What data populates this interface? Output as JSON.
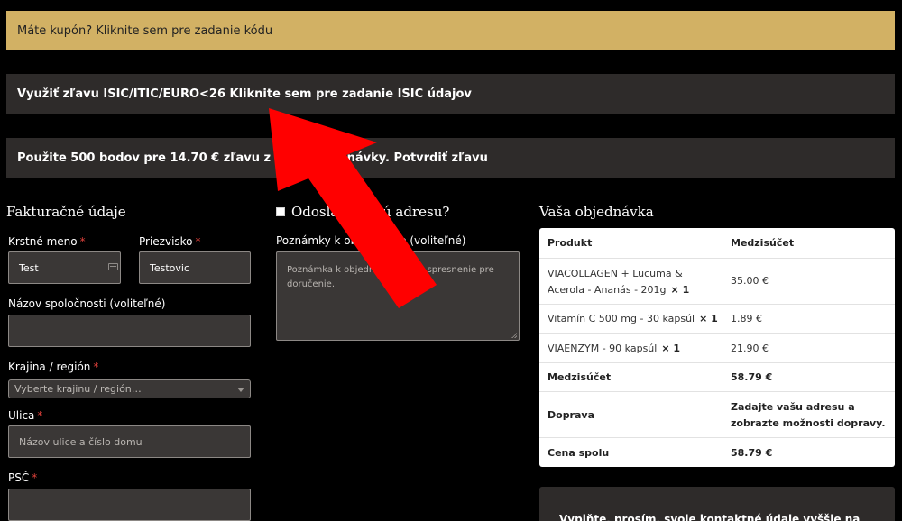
{
  "notices": {
    "coupon": "Máte kupón? Kliknite sem pre zadanie kódu",
    "isic": "Využiť zľavu ISIC/ITIC/EURO<26 Kliknite sem pre zadanie ISIC údajov",
    "points": "Použite 500 bodov pre 14.70 € zľavu z tejto objednávky. Potvrdiť zľavu"
  },
  "billing": {
    "heading": "Fakturačné údaje",
    "first_name_label": "Krstné meno",
    "first_name_value": "Test",
    "last_name_label": "Priezvisko",
    "last_name_value": "Testovic",
    "company_label": "Názov spoločnosti (voliteľné)",
    "country_label": "Krajina / región",
    "country_placeholder": "Vyberte krajinu / región…",
    "street_label": "Ulica",
    "street_placeholder": "Názov ulice a číslo domu",
    "zip_label": "PSČ",
    "required_mark": "*"
  },
  "shipping": {
    "different_address_label": "Odoslať na inú adresu?",
    "notes_label": "Poznámky k objednávke (voliteľné)",
    "notes_placeholder": "Poznámka k objednávke, napr. spresnenie pre doručenie."
  },
  "order": {
    "heading": "Vaša objednávka",
    "col_product": "Produkt",
    "col_subtotal": "Medzisúčet",
    "items": [
      {
        "name": "VIACOLLAGEN + Lucuma & Acerola - Ananás - 201g",
        "qty": "× 1",
        "price": "35.00 €"
      },
      {
        "name": "Vitamín C 500 mg - 30 kapsúl",
        "qty": "× 1",
        "price": "1.89 €"
      },
      {
        "name": "VIAENZYM - 90 kapsúl",
        "qty": "× 1",
        "price": "21.90 €"
      }
    ],
    "subtotal_label": "Medzisúčet",
    "subtotal_value": "58.79 €",
    "shipping_label": "Doprava",
    "shipping_value": "Zadajte vašu adresu a zobrazte možnosti dopravy.",
    "total_label": "Cena spolu",
    "total_value": "58.79 €"
  },
  "bottom_notice": "Vyplňte, prosím, svoje kontaktné údaje vyššie na",
  "colors": {
    "background": "#000000",
    "coupon_bar": "#d2b164",
    "dark_bar": "#2e2b2a",
    "required": "#e0413b",
    "annotation_arrow": "#ff0000"
  }
}
